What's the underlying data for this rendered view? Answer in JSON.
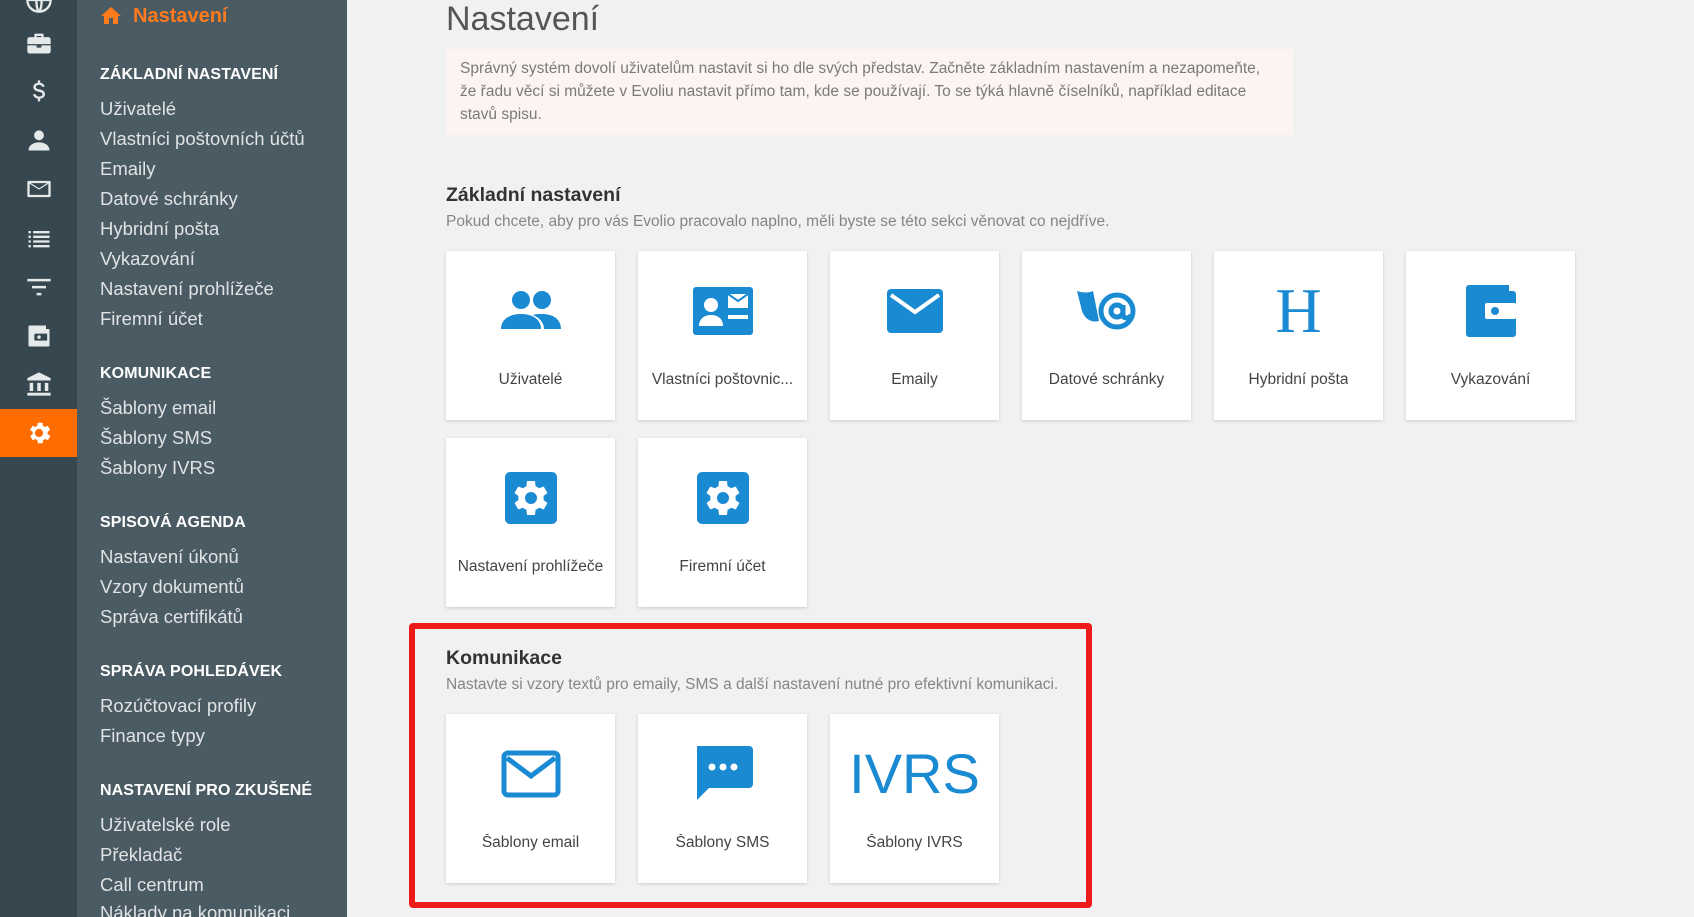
{
  "menu": {
    "home_label": "Nastavení",
    "sections": [
      {
        "title": "ZÁKLADNÍ NASTAVENÍ",
        "items": [
          "Uživatelé",
          "Vlastníci poštovních účtů",
          "Emaily",
          "Datové schránky",
          "Hybridní pošta",
          "Vykazování",
          "Nastavení prohlížeče",
          "Firemní účet"
        ]
      },
      {
        "title": "KOMUNIKACE",
        "items": [
          "Šablony email",
          "Šablony SMS",
          "Šablony IVRS"
        ]
      },
      {
        "title": "SPISOVÁ AGENDA",
        "items": [
          "Nastavení úkonů",
          "Vzory dokumentů",
          "Správa certifikátů"
        ]
      },
      {
        "title": "SPRÁVA POHLEDÁVEK",
        "items": [
          "Rozúčtovací profily",
          "Finance typy"
        ]
      },
      {
        "title": "NASTAVENÍ PRO ZKUŠENÉ",
        "items": [
          "Uživatelské role",
          "Překladač",
          "Call centrum",
          "Náklady na komunikaci"
        ]
      }
    ]
  },
  "rail_icons": [
    "globe-icon",
    "briefcase-icon",
    "dollar-icon",
    "person-icon",
    "mail-icon",
    "list-icon",
    "filter-icon",
    "wallet-icon",
    "bank-icon",
    "gear-icon"
  ],
  "main": {
    "title": "Nastavení",
    "intro": "Správný systém dovolí uživatelům nastavit si ho dle svých představ. Začněte základním nastavením a nezapomeňte, že řadu věcí si můžete v Evoliu nastavit přímo tam, kde se používají. To se týká hlavně číselníků, například editace stavů spisu.",
    "basic": {
      "title": "Základní nastavení",
      "description": "Pokud chcete, aby pro vás Evolio pracovalo naplno, měli byste se této sekci věnovat co nejdříve.",
      "tiles": [
        {
          "label": "Uživatelé",
          "icon": "users-icon"
        },
        {
          "label": "Vlastníci poštovnic...",
          "icon": "contact-card-icon"
        },
        {
          "label": "Emaily",
          "icon": "envelope-icon"
        },
        {
          "label": "Datové schránky",
          "icon": "data-box-icon"
        },
        {
          "label": "Hybridní pošta",
          "icon": "hybrid-mail-icon",
          "glyph": "H"
        },
        {
          "label": "Vykazování",
          "icon": "wallet-icon"
        },
        {
          "label": "Nastavení prohlížeče",
          "icon": "gear-icon"
        },
        {
          "label": "Firemní účet",
          "icon": "gear-icon"
        }
      ]
    },
    "communication": {
      "title": "Komunikace",
      "description": "Nastavte si vzory textů pro emaily, SMS a další nastavení nutné pro efektivní komunikaci.",
      "tiles": [
        {
          "label": "Šablony email",
          "icon": "envelope-outline-icon"
        },
        {
          "label": "Šablony SMS",
          "icon": "chat-bubble-icon"
        },
        {
          "label": "Šablony IVRS",
          "icon": "ivrs-icon",
          "glyph": "IVRS"
        }
      ]
    }
  },
  "colors": {
    "accent": "#ff6d00",
    "icon_blue": "#1a8ad3",
    "highlight": "#ee1a1a",
    "rail_bg": "#37474f",
    "menu_bg": "#4b5b63"
  }
}
